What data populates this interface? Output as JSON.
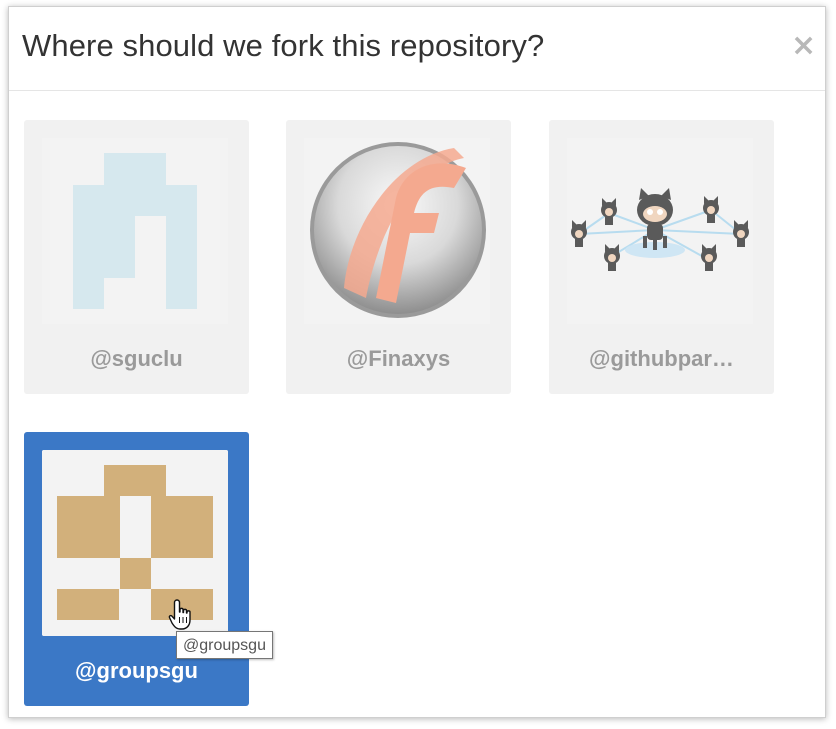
{
  "dialog": {
    "title": "Where should we fork this repository?",
    "close_symbol": "×"
  },
  "owners": [
    {
      "name": "@sguclu",
      "avatar": "identicon-light-blue",
      "avatar_color": "#d6e8ee",
      "selected": false
    },
    {
      "name": "@Finaxys",
      "avatar": "finaxys-logo",
      "avatar_color": "#f4a98f",
      "selected": false
    },
    {
      "name": "@githubpar…",
      "avatar": "octocat-network-icon",
      "avatar_color": "#5a5a5a",
      "selected": false
    },
    {
      "name": "@groupsgu",
      "avatar": "identicon-tan",
      "avatar_color": "#d2b07b",
      "selected": true
    }
  ],
  "tooltip": {
    "text": "@groupsgu"
  },
  "colors": {
    "selected_card": "#3b78c6",
    "card_background": "#f1f1f1",
    "label_text": "#9a9a9a"
  },
  "cursor": {
    "icon": "hand-pointer-icon"
  }
}
